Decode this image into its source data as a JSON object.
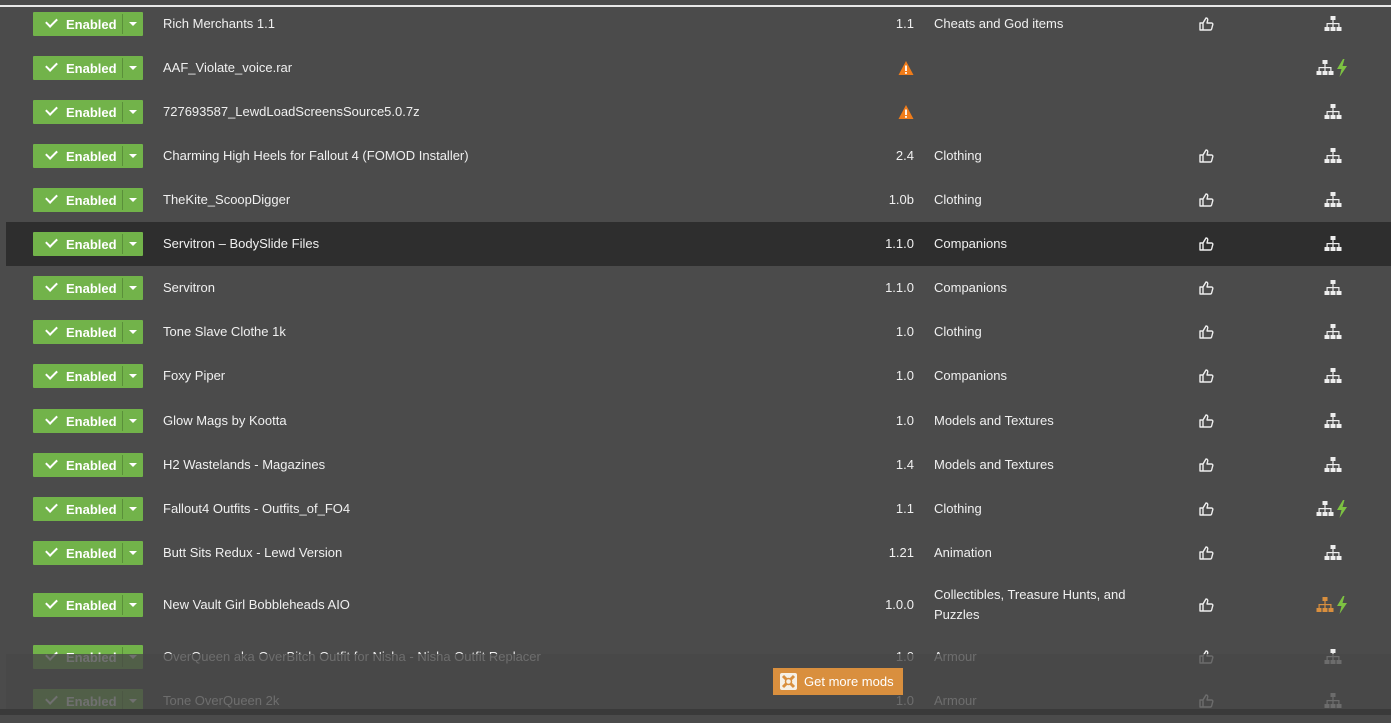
{
  "enabled_label": "Enabled",
  "footer": {
    "get_more_label": "Get more mods"
  },
  "colors": {
    "enabled_green": "#72b34a",
    "warning_orange": "#f07c1a",
    "bolt_green": "#7dc242",
    "button_orange": "#d98f3e"
  },
  "mods": [
    {
      "name": "Rich Merchants 1.1",
      "version": "1.1",
      "category": "Cheats and God items",
      "warning": false,
      "endorse": true,
      "bolt": false
    },
    {
      "name": "AAF_Violate_voice.rar",
      "version": "",
      "category": "",
      "warning": true,
      "endorse": false,
      "bolt": true
    },
    {
      "name": "727693587_LewdLoadScreensSource5.0.7z",
      "version": "",
      "category": "",
      "warning": true,
      "endorse": false,
      "bolt": false
    },
    {
      "name": "Charming High Heels for Fallout 4 (FOMOD Installer)",
      "version": "2.4",
      "category": "Clothing",
      "warning": false,
      "endorse": true,
      "bolt": false
    },
    {
      "name": "TheKite_ScoopDigger",
      "version": "1.0b",
      "category": "Clothing",
      "warning": false,
      "endorse": true,
      "bolt": false
    },
    {
      "name": "Servitron – BodySlide Files",
      "version": "1.1.0",
      "category": "Companions",
      "warning": false,
      "endorse": true,
      "bolt": false,
      "selected": true
    },
    {
      "name": "Servitron",
      "version": "1.1.0",
      "category": "Companions",
      "warning": false,
      "endorse": true,
      "bolt": false
    },
    {
      "name": "Tone Slave Clothe 1k",
      "version": "1.0",
      "category": "Clothing",
      "warning": false,
      "endorse": true,
      "bolt": false
    },
    {
      "name": "Foxy Piper",
      "version": "1.0",
      "category": "Companions",
      "warning": false,
      "endorse": true,
      "bolt": false
    },
    {
      "name": "Glow Mags by Kootta",
      "version": "1.0",
      "category": "Models and Textures",
      "warning": false,
      "endorse": true,
      "bolt": false
    },
    {
      "name": "H2 Wastelands - Magazines",
      "version": "1.4",
      "category": "Models and Textures",
      "warning": false,
      "endorse": true,
      "bolt": false
    },
    {
      "name": "Fallout4 Outfits - Outfits_of_FO4",
      "version": "1.1",
      "category": "Clothing",
      "warning": false,
      "endorse": true,
      "bolt": true
    },
    {
      "name": "Butt Sits Redux - Lewd Version",
      "version": "1.21",
      "category": "Animation",
      "warning": false,
      "endorse": true,
      "bolt": false
    },
    {
      "name": "New Vault Girl Bobbleheads AIO",
      "version": "1.0.0",
      "category": "Collectibles, Treasure Hunts, and Puzzles",
      "warning": false,
      "endorse": true,
      "bolt": true,
      "dep_orange": true
    },
    {
      "name": "OverQueen aka OverBitch Outfit for Nisha - Nisha Outfit Replacer",
      "version": "1.0",
      "category": "Armour",
      "warning": false,
      "endorse": true,
      "bolt": false
    },
    {
      "name": "Tone OverQueen 2k",
      "version": "1.0",
      "category": "Armour",
      "warning": false,
      "endorse": true,
      "bolt": false
    }
  ]
}
